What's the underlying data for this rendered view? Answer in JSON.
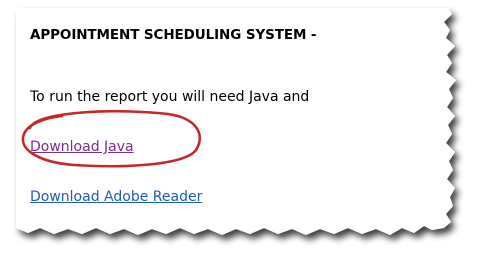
{
  "panel": {
    "title": "APPOINTMENT SCHEDULING SYSTEM -",
    "instruction": "To run the report you will need Java and",
    "links": {
      "java": "Download Java",
      "adobe": "Download Adobe Reader"
    }
  },
  "annotation": {
    "highlight": "circled-link",
    "highlight_color": "#c62828"
  },
  "colors": {
    "visited_link": "#7a2e8e",
    "link": "#1b5fb4",
    "text": "#000000",
    "shadow": "#3a3a3a"
  }
}
